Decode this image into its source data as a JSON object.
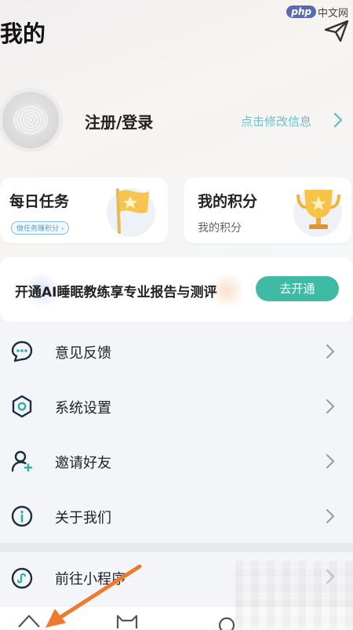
{
  "watermark": {
    "brand": "php",
    "site": "中文网"
  },
  "header": {
    "title": "我的"
  },
  "profile": {
    "login_label": "注册/登录",
    "edit_info": "点击修改信息"
  },
  "cards": {
    "daily_task": {
      "title": "每日任务",
      "pill": "做任务赚积分"
    },
    "points": {
      "title": "我的积分",
      "subtitle": "我的积分"
    }
  },
  "promo": {
    "text": "开通AI睡眠教练享专业报告与测评",
    "button": "去开通"
  },
  "menu": {
    "items": [
      {
        "label": "意见反馈",
        "icon": "feedback-icon"
      },
      {
        "label": "系统设置",
        "icon": "settings-icon"
      },
      {
        "label": "邀请好友",
        "icon": "invite-friend-icon"
      },
      {
        "label": "关于我们",
        "icon": "info-icon"
      },
      {
        "label": "前往小程序",
        "icon": "mini-program-icon"
      }
    ]
  },
  "colors": {
    "accent": "#3fbaa5",
    "link": "#6cc1c5",
    "annotation_arrow": "#ef7a2e"
  }
}
